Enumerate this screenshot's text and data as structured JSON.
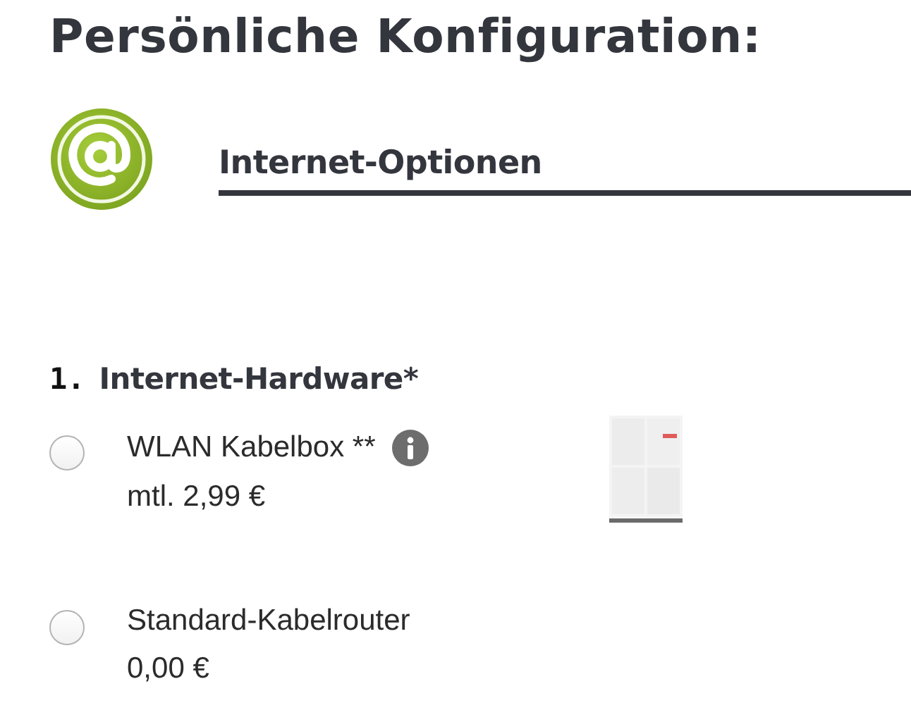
{
  "title": "Persönliche Konfiguration:",
  "section": {
    "title": "Internet-Optionen"
  },
  "question": {
    "number": "1.",
    "label": "Internet-Hardware*"
  },
  "options": [
    {
      "label": "WLAN Kabelbox **",
      "price": "mtl. 2,99 €",
      "selected": false,
      "info": true
    },
    {
      "label": "Standard-Kabelrouter",
      "price": "0,00 €",
      "selected": false,
      "info": false
    }
  ]
}
